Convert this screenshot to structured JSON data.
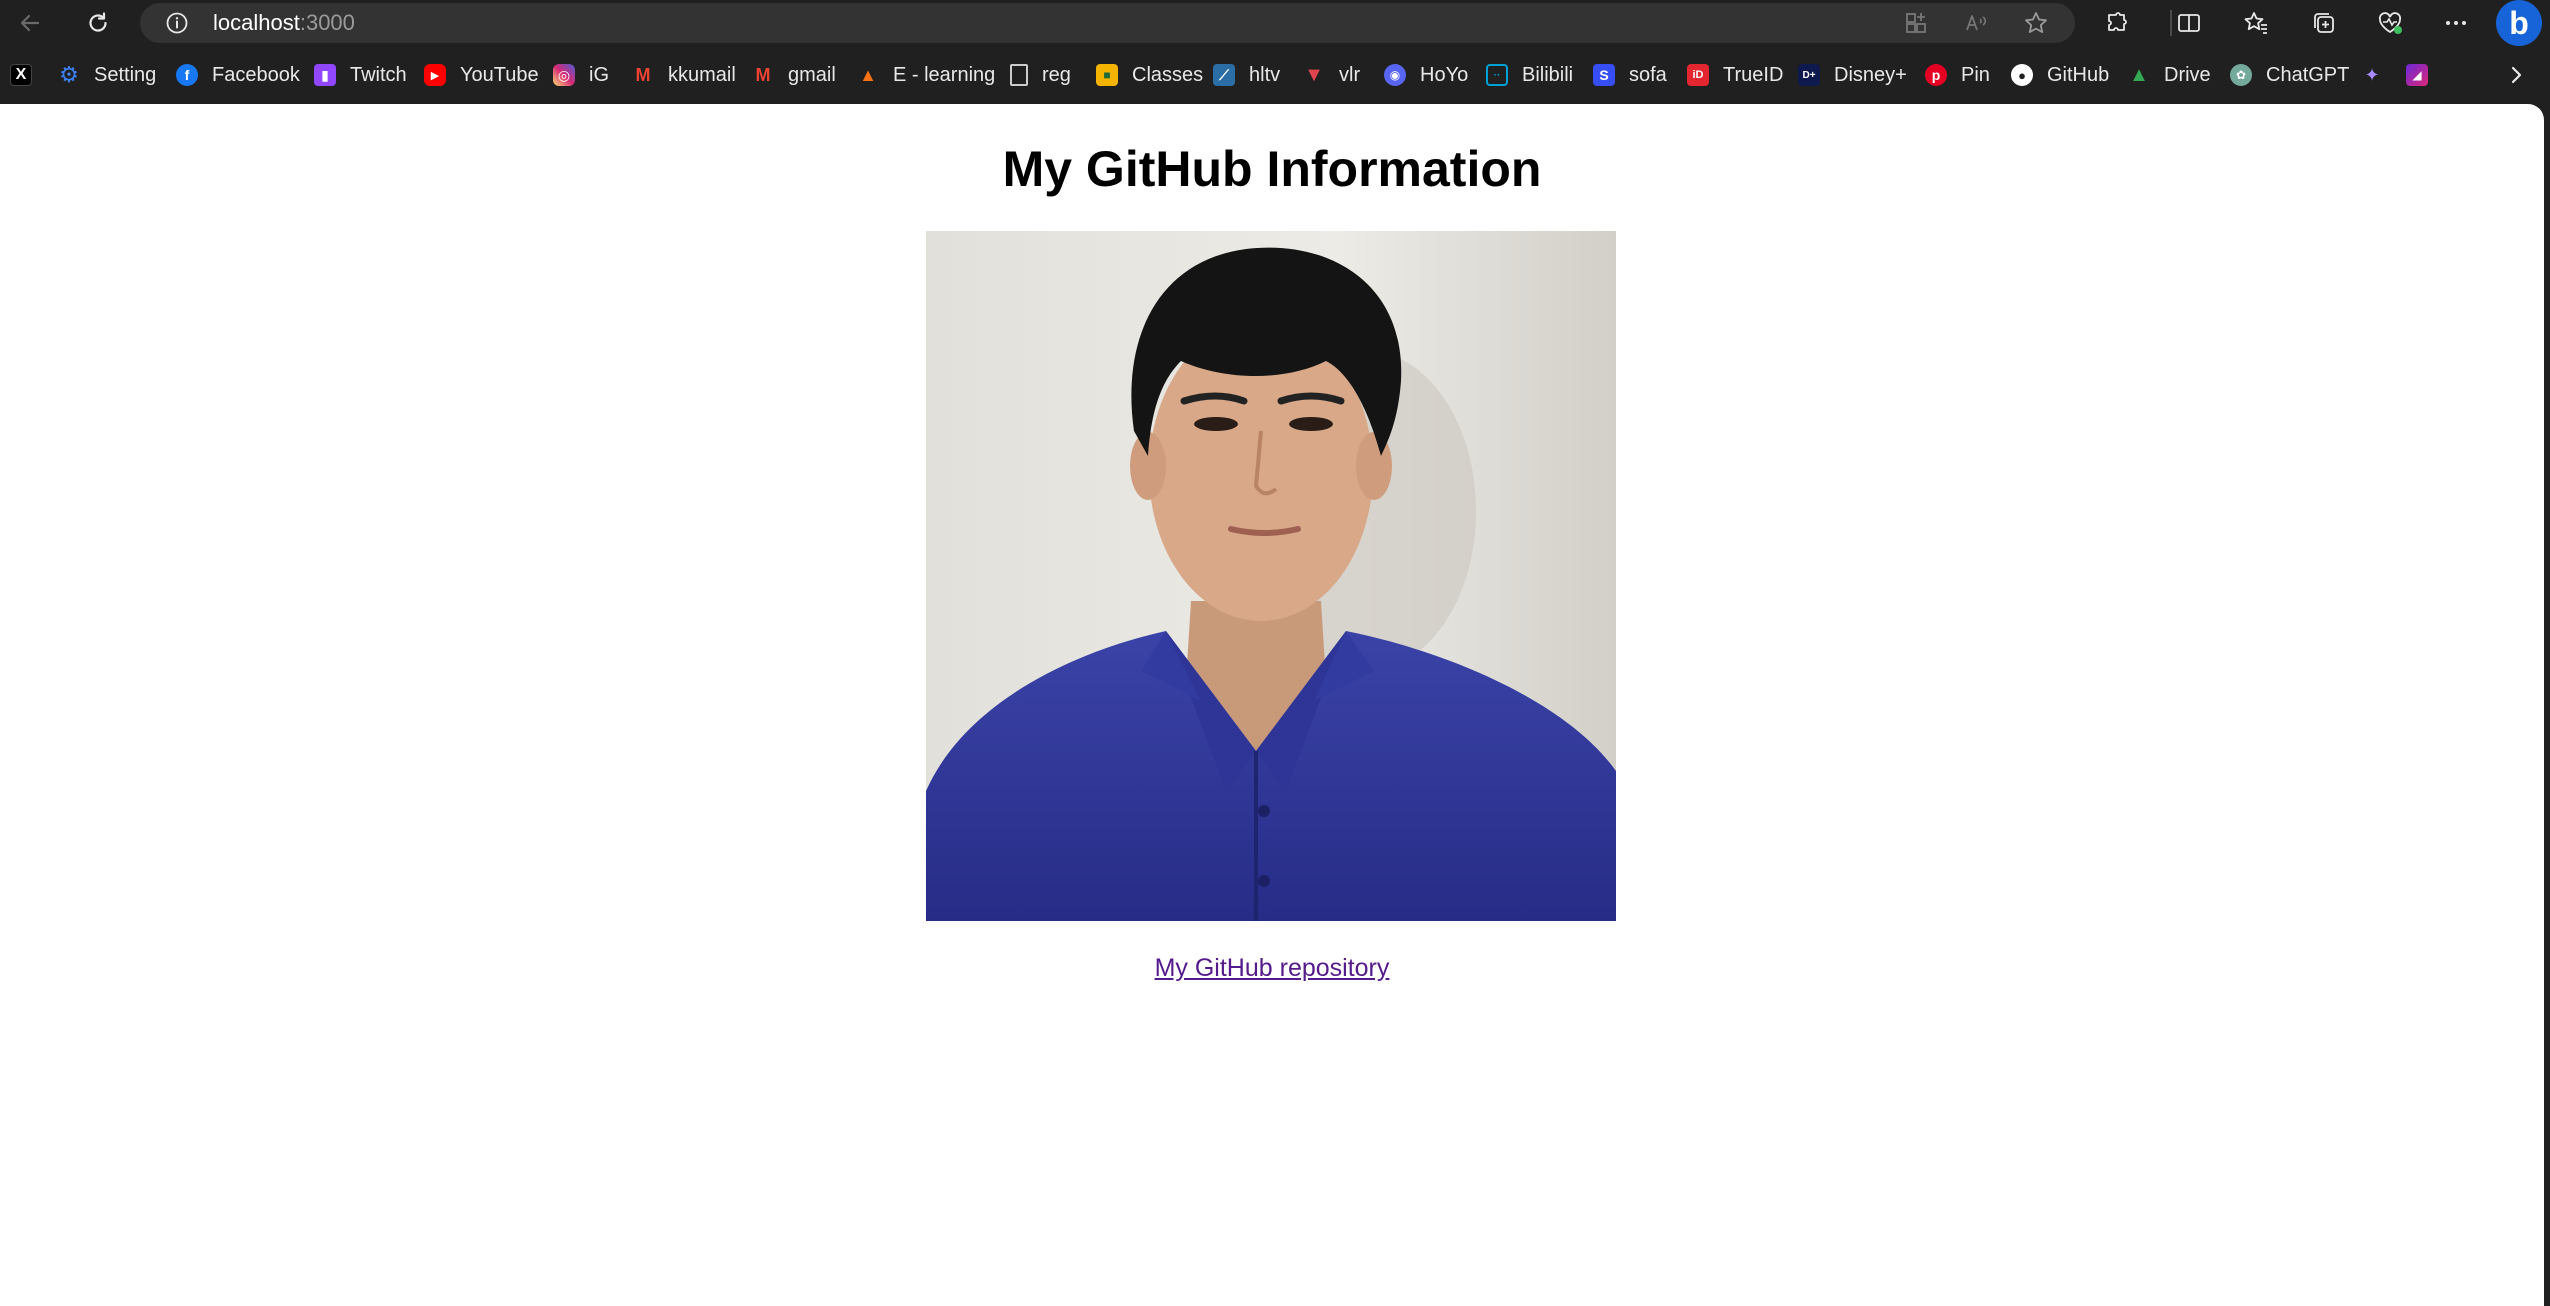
{
  "browser": {
    "url_host": "localhost",
    "url_port": ":3000"
  },
  "bookmarks": [
    {
      "label": "",
      "icon": "x-icon",
      "color": "#ffffff"
    },
    {
      "label": "Setting",
      "icon": "gear-icon",
      "color": "#3b82f6"
    },
    {
      "label": "Facebook",
      "icon": "facebook-icon",
      "color": "#1877f2"
    },
    {
      "label": "Twitch",
      "icon": "twitch-icon",
      "color": "#9146ff"
    },
    {
      "label": "YouTube",
      "icon": "youtube-icon",
      "color": "#ff0000"
    },
    {
      "label": "iG",
      "icon": "instagram-icon",
      "color": "#d62976"
    },
    {
      "label": "kkumail",
      "icon": "gmail-icon",
      "color": "#ea4335"
    },
    {
      "label": "gmail",
      "icon": "gmail-icon",
      "color": "#ea4335"
    },
    {
      "label": "E - learning",
      "icon": "rocket-icon",
      "color": "#c2410c"
    },
    {
      "label": "reg",
      "icon": "page-icon",
      "color": "#cccccc"
    },
    {
      "label": "Classes",
      "icon": "classroom-icon",
      "color": "#f4b400"
    },
    {
      "label": "hltv",
      "icon": "hltv-icon",
      "color": "#2b6ea6"
    },
    {
      "label": "vlr",
      "icon": "vlr-icon",
      "color": "#e0454f"
    },
    {
      "label": "HoYo",
      "icon": "discord-icon",
      "color": "#5865f2"
    },
    {
      "label": "Bilibili",
      "icon": "bilibili-icon",
      "color": "#00a1d6"
    },
    {
      "label": "sofa",
      "icon": "sofascore-icon",
      "color": "#374df5"
    },
    {
      "label": "TrueID",
      "icon": "trueid-icon",
      "color": "#e3262f"
    },
    {
      "label": "Disney+",
      "icon": "disney-icon",
      "color": "#0e1a4d"
    },
    {
      "label": "Pin",
      "icon": "pinterest-icon",
      "color": "#e60023"
    },
    {
      "label": "GitHub",
      "icon": "github-icon",
      "color": "#ffffff"
    },
    {
      "label": "Drive",
      "icon": "drive-icon",
      "color": "#34a853"
    },
    {
      "label": "ChatGPT",
      "icon": "chatgpt-icon",
      "color": "#74aa9c"
    },
    {
      "label": "",
      "icon": "app-icon",
      "color": "#8b5cf6"
    },
    {
      "label": "",
      "icon": "app-icon",
      "color": "#a855f7"
    }
  ],
  "page": {
    "title": "My GitHub Information",
    "link_text": "My GitHub repository",
    "link_color": "#551a8b"
  }
}
